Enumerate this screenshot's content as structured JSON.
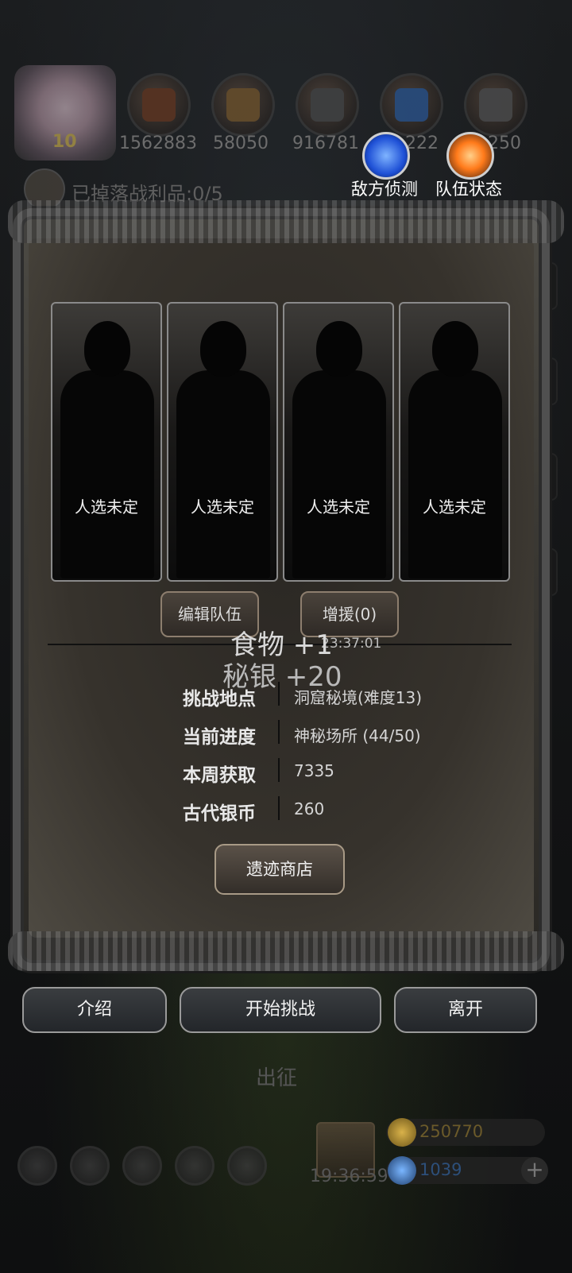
{
  "top_bar": {
    "avatar_level": "10",
    "resources": [
      {
        "icon": "food-icon",
        "value": "1562883"
      },
      {
        "icon": "wood-icon",
        "value": "58050"
      },
      {
        "icon": "iron-icon",
        "value": "916781"
      },
      {
        "icon": "crystal-icon",
        "value": "222"
      },
      {
        "icon": "stone-icon",
        "value": "250"
      }
    ],
    "loot_text": "已掉落战利品:0/5",
    "enemy_scan_label": "敌方侦测",
    "team_status_label": "队伍状态"
  },
  "team": {
    "slots": [
      {
        "label": "人选未定"
      },
      {
        "label": "人选未定"
      },
      {
        "label": "人选未定"
      },
      {
        "label": "人选未定"
      }
    ],
    "edit_button": "编辑队伍",
    "reinforce_button": "增援(0)",
    "timer": "23:37:01"
  },
  "floating": {
    "food": "食物 +1",
    "silver": "秘银 +20"
  },
  "info": [
    {
      "label": "挑战地点",
      "value": "洞窟秘境(难度13)"
    },
    {
      "label": "当前进度",
      "value": "神秘场所 (44/50)"
    },
    {
      "label": "本周获取",
      "value": "7335"
    },
    {
      "label": "古代银币",
      "value": "260"
    }
  ],
  "shop_button": "遗迹商店",
  "actions": {
    "intro": "介绍",
    "start": "开始挑战",
    "leave": "离开"
  },
  "dispatch_label": "出征",
  "bottom_hud": {
    "time": "19:36:59",
    "gold": "250770",
    "gems": "1039",
    "plus": "+"
  },
  "colors": {
    "gold_text": "#6b5a2a",
    "gem_text": "#2d4f7a",
    "skill_blue": "#2a6fff",
    "skill_fire": "#ff7a1a"
  }
}
